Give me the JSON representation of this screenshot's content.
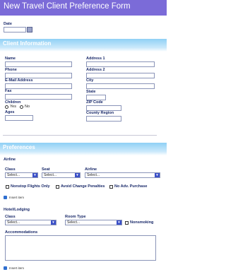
{
  "form": {
    "title": "New Travel Client Preference Form"
  },
  "date": {
    "label": "Date",
    "value": ""
  },
  "client": {
    "heading": "Client Information",
    "name": "Name",
    "phone": "Phone",
    "email": "E-Mail Address",
    "fax": "Fax",
    "children": "Children",
    "yes": "Yes",
    "no": "No",
    "ages": "Ages",
    "address1": "Address 1",
    "address2": "Address 2",
    "city": "City",
    "state": "State",
    "zip": "ZIP Code",
    "county": "County Region"
  },
  "preferences": {
    "heading": "Preferences",
    "airline_heading": "Airline",
    "class_label": "Class",
    "seat_label": "Seat",
    "airline_label": "Airline",
    "select_placeholder": "Select...",
    "nonstop": "Nonstop Flights Only",
    "avoid": "Avoid Change Penalties",
    "noadv": "No Adv. Purchase",
    "insert_item": "Insert item",
    "hotel_heading": "Hotel/Lodging",
    "hotel_class": "Class",
    "room_type": "Room Type",
    "nonsmoking": "Nonsmoking",
    "accommodations": "Accommodations"
  }
}
